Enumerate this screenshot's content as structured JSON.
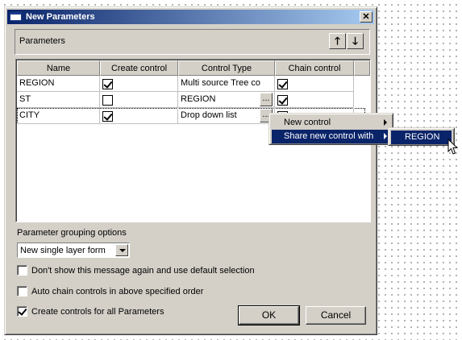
{
  "window": {
    "title": "New Parameters",
    "close_symbol": "✕"
  },
  "parameters_panel": {
    "label": "Parameters",
    "move_up_symbol": "🡑",
    "move_down_symbol": "🡓"
  },
  "grid": {
    "columns": [
      "Name",
      "Create control",
      "Control Type",
      "Chain control"
    ],
    "ellipsis": "...",
    "rows": [
      {
        "name": "REGION",
        "create_control": true,
        "control_type": "Multi source Tree co",
        "chain_control": true
      },
      {
        "name": "ST",
        "create_control": false,
        "control_type": "REGION",
        "chain_control": true
      },
      {
        "name": "CITY",
        "create_control": true,
        "control_type": "Drop down list",
        "chain_control": false
      }
    ]
  },
  "context_menu": {
    "items": [
      "New control",
      "Share new control with"
    ],
    "submenu_items": [
      "REGION"
    ]
  },
  "grouping": {
    "label": "Parameter grouping options",
    "selected": "New single layer form"
  },
  "options": [
    {
      "label": "Don't show this message again and use default selection",
      "checked": false
    },
    {
      "label": "Auto chain controls in above specified order",
      "checked": false
    },
    {
      "label": "Create controls for all Parameters",
      "checked": true
    }
  ],
  "buttons": {
    "ok": "OK",
    "cancel": "Cancel"
  },
  "colors": {
    "titlebar_start": "#0a246a",
    "titlebar_end": "#a6caf0",
    "face": "#d4d0c8",
    "highlight": "#0a246a"
  }
}
